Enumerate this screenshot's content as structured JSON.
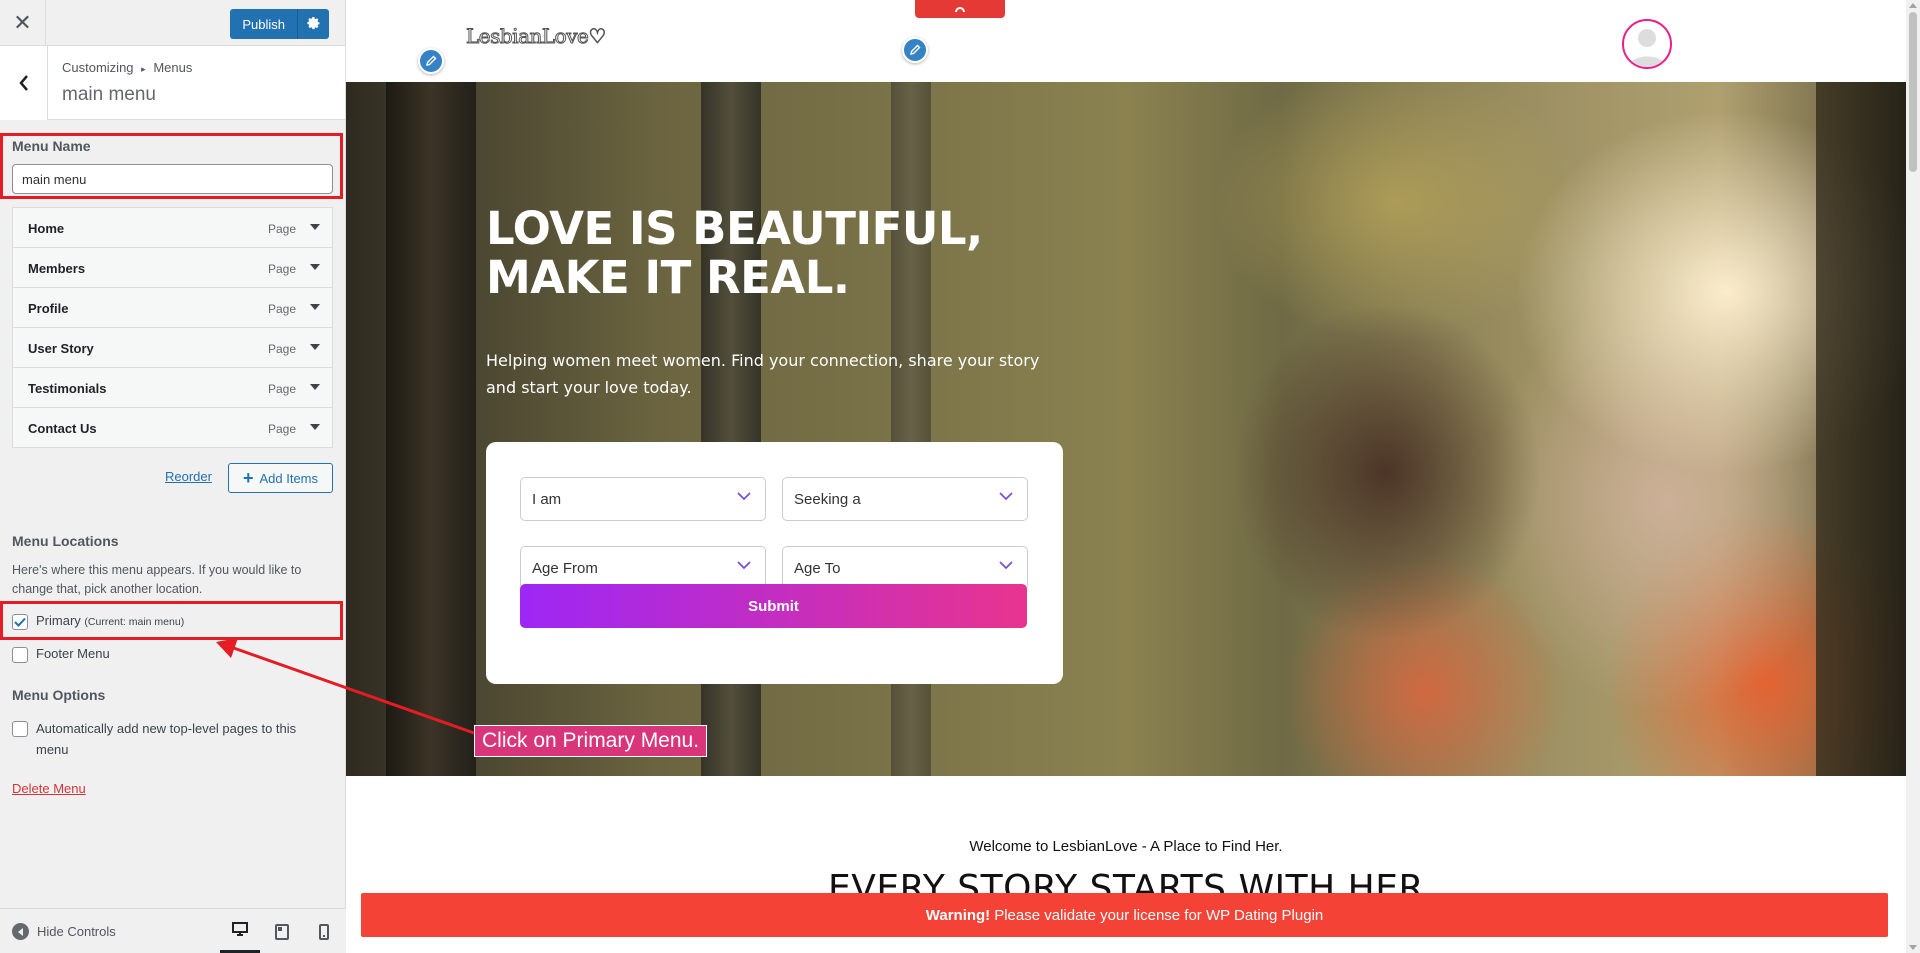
{
  "sidebar": {
    "close_icon": "close-icon",
    "publish_label": "Publish",
    "breadcrumb_root": "Customizing",
    "breadcrumb_sep": "▸",
    "breadcrumb_section": "Menus",
    "section_title": "main menu",
    "menu_name_label": "Menu Name",
    "menu_name_value": "main menu",
    "menu_items": [
      {
        "title": "Home",
        "type": "Page"
      },
      {
        "title": "Members",
        "type": "Page"
      },
      {
        "title": "Profile",
        "type": "Page"
      },
      {
        "title": "User Story",
        "type": "Page"
      },
      {
        "title": "Testimonials",
        "type": "Page"
      },
      {
        "title": "Contact Us",
        "type": "Page"
      }
    ],
    "reorder_label": "Reorder",
    "add_items_label": "Add Items",
    "locations_heading": "Menu Locations",
    "locations_desc": "Here's where this menu appears. If you would like to change that, pick another location.",
    "primary_label": "Primary",
    "primary_current": "(Current: main menu)",
    "primary_checked": true,
    "footer_menu_label": "Footer Menu",
    "options_heading": "Menu Options",
    "auto_add_label": "Automatically add new top-level pages to this menu",
    "delete_menu_label": "Delete Menu",
    "hide_controls_label": "Hide Controls"
  },
  "site": {
    "logo_text": "LesbianLove♡",
    "hero_title_line1": "LOVE IS BEAUTIFUL,",
    "hero_title_line2": "MAKE IT REAL.",
    "hero_subtitle": "Helping women meet women. Find your connection, share your story and start your love today.",
    "search": {
      "i_am": "I am",
      "seeking": "Seeking a",
      "age_from": "Age From",
      "age_to": "Age To",
      "submit": "Submit"
    },
    "welcome": "Welcome to LesbianLove - A Place to Find Her.",
    "story_heading": "EVERY STORY STARTS WITH HER",
    "warning_bold": "Warning!",
    "warning_text": "Please validate your license for WP Dating Plugin"
  },
  "annotation": {
    "label": "Click on Primary Menu."
  },
  "colors": {
    "wp_blue": "#2271b1",
    "highlight_red": "#e51c23",
    "submit_gradient_start": "#9d27f5",
    "submit_gradient_end": "#e8348e",
    "warning_red": "#f44336",
    "annotation_pink": "#d8357a"
  }
}
